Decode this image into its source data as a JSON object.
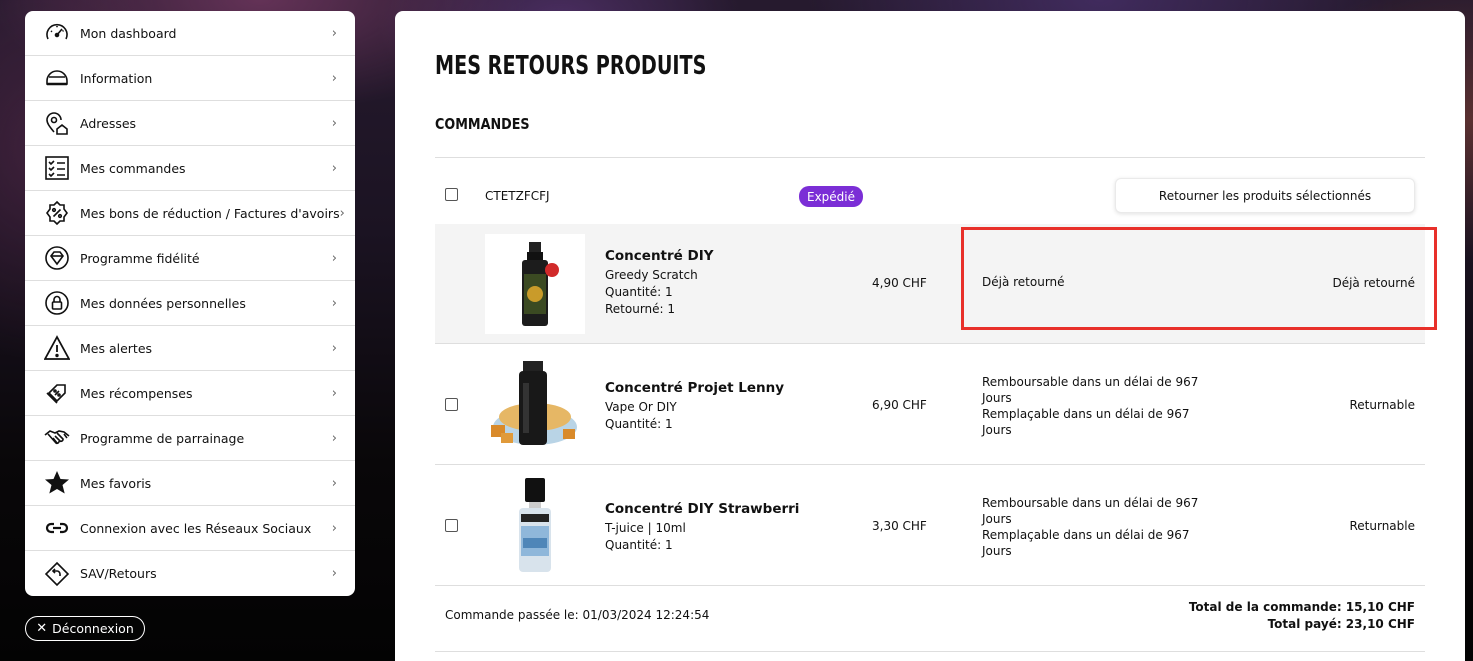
{
  "sidebar": {
    "items": [
      {
        "label": "Mon dashboard",
        "icon": "gauge-icon"
      },
      {
        "label": "Information",
        "icon": "helmet-icon"
      },
      {
        "label": "Adresses",
        "icon": "location-home-icon"
      },
      {
        "label": "Mes commandes",
        "icon": "checklist-icon"
      },
      {
        "label": "Mes bons de réduction / Factures d'avoirs",
        "icon": "discount-badge-icon"
      },
      {
        "label": "Programme fidélité",
        "icon": "diamond-icon"
      },
      {
        "label": "Mes données personnelles",
        "icon": "lock-icon"
      },
      {
        "label": "Mes alertes",
        "icon": "warning-icon"
      },
      {
        "label": "Mes récompenses",
        "icon": "coupon-icon"
      },
      {
        "label": "Programme de parrainage",
        "icon": "handshake-icon"
      },
      {
        "label": "Mes favoris",
        "icon": "star-icon"
      },
      {
        "label": "Connexion avec les Réseaux Sociaux",
        "icon": "link-icon"
      },
      {
        "label": "SAV/Retours",
        "icon": "return-icon"
      }
    ],
    "chevron": "›",
    "logout_label": "Déconnexion"
  },
  "main": {
    "title": "MES RETOURS PRODUITS",
    "section_title": "COMMANDES",
    "order": {
      "id": "CTETZFCFJ",
      "status": "Expédié",
      "return_button": "Retourner les produits sélectionnés",
      "products": [
        {
          "name": "Concentré DIY",
          "brand": "Greedy Scratch",
          "quantity": "Quantité: 1",
          "returned": "Retourné: 1",
          "price": "4,90 CHF",
          "info": [
            "Déjà retourné"
          ],
          "status": "Déjà retourné"
        },
        {
          "name": "Concentré Projet Lenny",
          "brand": "Vape Or DIY",
          "quantity": "Quantité: 1",
          "price": "6,90 CHF",
          "info": [
            "Remboursable dans un délai de 967",
            "Jours",
            "Remplaçable dans un délai de 967",
            "Jours"
          ],
          "status": "Returnable"
        },
        {
          "name": "Concentré DIY Strawberri",
          "brand": "T-juice | 10ml",
          "quantity": "Quantité: 1",
          "price": "3,30 CHF",
          "info": [
            "Remboursable dans un délai de 967",
            "Jours",
            "Remplaçable dans un délai de 967",
            "Jours"
          ],
          "status": "Returnable"
        }
      ],
      "date": "Commande passée le: 01/03/2024 12:24:54",
      "total_order": "Total de la commande: 15,10 CHF",
      "total_paid": "Total payé: 23,10 CHF"
    }
  }
}
